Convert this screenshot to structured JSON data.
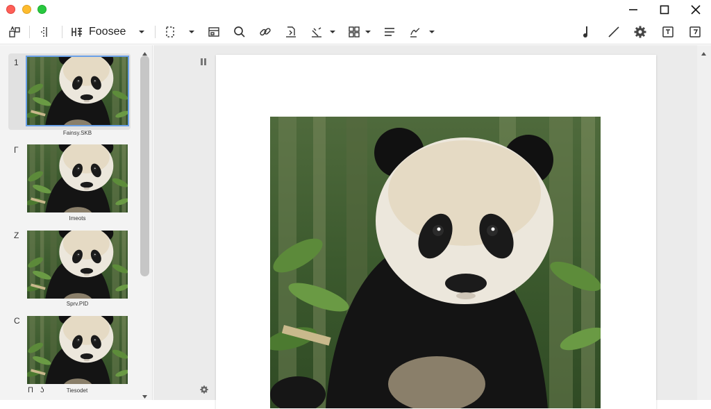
{
  "window": {
    "controls": [
      "close",
      "minimize",
      "zoom"
    ],
    "right_controls": [
      "minimize-icon",
      "maximize-icon",
      "close-icon"
    ]
  },
  "toolbar": {
    "font_name": "Foosee",
    "icons": [
      "shapes-icon",
      "columns-icon",
      "font-icon",
      "chevron-down-icon",
      "select-icon",
      "frame-icon",
      "search-icon",
      "link-icon",
      "insert-icon",
      "draw-icon",
      "grid-icon",
      "align-icon",
      "signature-icon",
      "pen-icon",
      "line-icon",
      "gear-icon",
      "export-icon",
      "share-icon"
    ]
  },
  "sidebar": {
    "pages": [
      {
        "number": "1",
        "caption": "Fainsy.SKB",
        "selected": true
      },
      {
        "number": "Γ",
        "caption": "Imeots",
        "selected": false
      },
      {
        "number": "Z",
        "caption": "Sprv.PID",
        "selected": false
      },
      {
        "number": "C",
        "caption": "Tiesodet",
        "selected": false
      }
    ],
    "bottom_glyphs": [
      "Π",
      "ʖ"
    ]
  },
  "main": {
    "page_image": "giant-panda-photo"
  },
  "colors": {
    "selection": "#6aa0e8",
    "sidebar_bg": "#f3f3f3",
    "canvas_bg": "#ebebeb"
  }
}
